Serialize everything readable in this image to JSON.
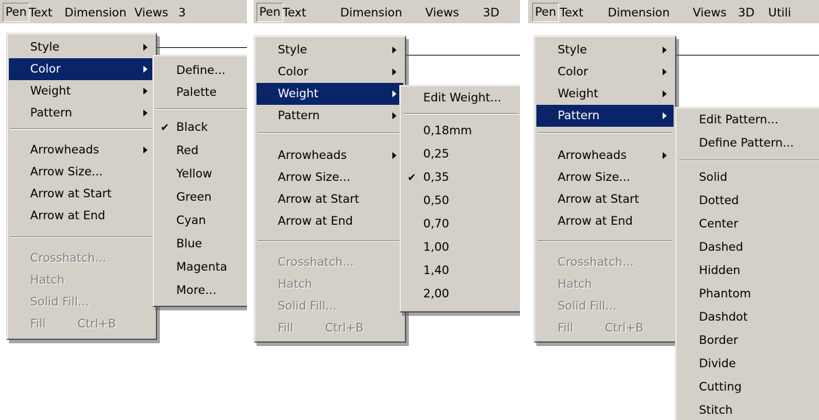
{
  "panels": [
    {
      "menubar": [
        "Pen",
        "Text",
        "Dimension",
        "Views",
        "3"
      ],
      "pen_menu": {
        "items": [
          {
            "label": "Style",
            "submenu": true
          },
          {
            "label": "Color",
            "submenu": true,
            "selected": true
          },
          {
            "label": "Weight",
            "submenu": true
          },
          {
            "label": "Pattern",
            "submenu": true
          },
          {
            "label": "Arrowheads",
            "submenu": true
          },
          {
            "label": "Arrow Size..."
          },
          {
            "label": "Arrow at Start"
          },
          {
            "label": "Arrow at End"
          },
          {
            "label": "Crosshatch...",
            "disabled": true
          },
          {
            "label": "Hatch",
            "disabled": true
          },
          {
            "label": "Solid Fill...",
            "disabled": true
          },
          {
            "label": "Fill",
            "shortcut": "Ctrl+B",
            "disabled": true
          }
        ]
      },
      "submenu": {
        "items": [
          {
            "label": "Define..."
          },
          {
            "label": "Palette"
          },
          {
            "label": "Black",
            "checked": true
          },
          {
            "label": "Red"
          },
          {
            "label": "Yellow"
          },
          {
            "label": "Green"
          },
          {
            "label": "Cyan"
          },
          {
            "label": "Blue"
          },
          {
            "label": "Magenta"
          },
          {
            "label": "More..."
          }
        ]
      }
    },
    {
      "menubar": [
        "Pen",
        "Text",
        "Dimension",
        "Views",
        "3D"
      ],
      "pen_menu": {
        "items": [
          {
            "label": "Style",
            "submenu": true
          },
          {
            "label": "Color",
            "submenu": true
          },
          {
            "label": "Weight",
            "submenu": true,
            "selected": true
          },
          {
            "label": "Pattern",
            "submenu": true
          },
          {
            "label": "Arrowheads",
            "submenu": true
          },
          {
            "label": "Arrow Size..."
          },
          {
            "label": "Arrow at Start"
          },
          {
            "label": "Arrow at End"
          },
          {
            "label": "Crosshatch...",
            "disabled": true
          },
          {
            "label": "Hatch",
            "disabled": true
          },
          {
            "label": "Solid Fill...",
            "disabled": true
          },
          {
            "label": "Fill",
            "shortcut": "Ctrl+B",
            "disabled": true
          }
        ]
      },
      "submenu": {
        "items": [
          {
            "label": "Edit Weight..."
          },
          {
            "label": "0,18mm"
          },
          {
            "label": "0,25"
          },
          {
            "label": "0,35",
            "checked": true
          },
          {
            "label": "0,50"
          },
          {
            "label": "0,70"
          },
          {
            "label": "1,00"
          },
          {
            "label": "1,40"
          },
          {
            "label": "2,00"
          }
        ]
      }
    },
    {
      "menubar": [
        "Pen",
        "Text",
        "Dimension",
        "Views",
        "3D",
        "Utili"
      ],
      "pen_menu": {
        "items": [
          {
            "label": "Style",
            "submenu": true
          },
          {
            "label": "Color",
            "submenu": true
          },
          {
            "label": "Weight",
            "submenu": true
          },
          {
            "label": "Pattern",
            "submenu": true,
            "selected": true
          },
          {
            "label": "Arrowheads",
            "submenu": true
          },
          {
            "label": "Arrow Size..."
          },
          {
            "label": "Arrow at Start"
          },
          {
            "label": "Arrow at End"
          },
          {
            "label": "Crosshatch...",
            "disabled": true
          },
          {
            "label": "Hatch",
            "disabled": true
          },
          {
            "label": "Solid Fill...",
            "disabled": true
          },
          {
            "label": "Fill",
            "shortcut": "Ctrl+B",
            "disabled": true
          }
        ]
      },
      "submenu": {
        "items": [
          {
            "label": "Edit Pattern..."
          },
          {
            "label": "Define Pattern..."
          },
          {
            "label": "Solid"
          },
          {
            "label": "Dotted"
          },
          {
            "label": "Center"
          },
          {
            "label": "Dashed"
          },
          {
            "label": "Hidden"
          },
          {
            "label": "Phantom"
          },
          {
            "label": "Dashdot"
          },
          {
            "label": "Border"
          },
          {
            "label": "Divide"
          },
          {
            "label": "Cutting"
          },
          {
            "label": "Stitch"
          }
        ]
      }
    }
  ],
  "colors": {
    "menu_face": "#d4d0c8",
    "highlight": "#0a246a",
    "disabled_text": "#808080"
  },
  "icons": {
    "submenu_arrow": "triangle-right-icon",
    "checkmark": "checkmark-icon"
  }
}
